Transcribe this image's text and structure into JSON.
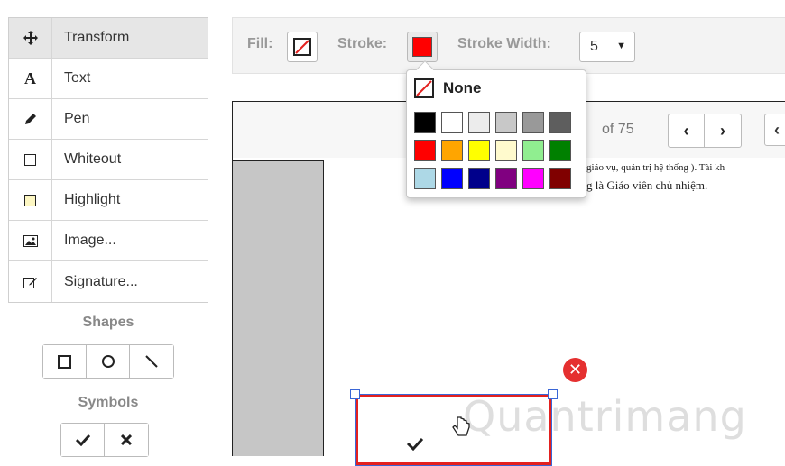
{
  "tools": [
    {
      "label": "Transform",
      "icon": "move-icon"
    },
    {
      "label": "Text",
      "icon": "text-icon"
    },
    {
      "label": "Pen",
      "icon": "pen-icon"
    },
    {
      "label": "Whiteout",
      "icon": "whiteout-icon"
    },
    {
      "label": "Highlight",
      "icon": "highlight-icon"
    },
    {
      "label": "Image...",
      "icon": "image-icon"
    },
    {
      "label": "Signature...",
      "icon": "signature-icon"
    }
  ],
  "shapes_title": "Shapes",
  "symbols_title": "Symbols",
  "toolbar": {
    "fill_label": "Fill:",
    "stroke_label": "Stroke:",
    "stroke_width_label": "Stroke Width:",
    "stroke_width_value": "5",
    "stroke_color": "#ff0000"
  },
  "popup": {
    "none_label": "None",
    "colors": [
      "#000000",
      "#ffffff",
      "#ececec",
      "#c8c8c8",
      "#999999",
      "#5e5e5e",
      "#ff0000",
      "#ffa500",
      "#ffff00",
      "#fffacd",
      "#90ee90",
      "#008000",
      "#add8e6",
      "#0000ff",
      "#00008b",
      "#800080",
      "#ff00ff",
      "#800000"
    ]
  },
  "pager": {
    "of_total": "of 75"
  },
  "doc": {
    "line1": "giáo vụ, quản trị hệ thống ). Tài kh",
    "line2": "g là Giáo viên chủ nhiệm."
  },
  "watermark": "Quantrimang"
}
